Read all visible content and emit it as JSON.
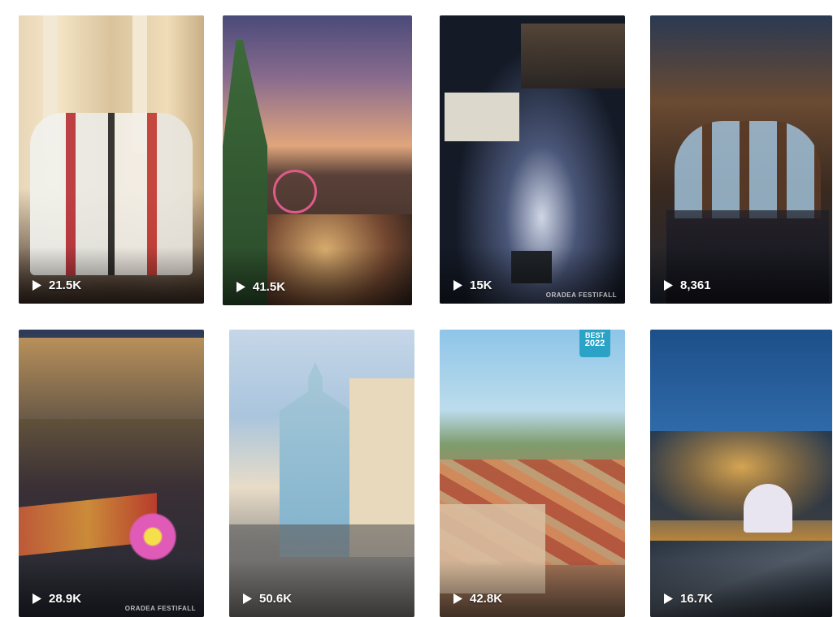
{
  "tiles": [
    {
      "count": "21.5K",
      "color": "#d9c39c"
    },
    {
      "count": "41.5K",
      "color": "#8a6c8e"
    },
    {
      "count": "15K",
      "color": "#141a26",
      "watermark": "ORADEA FESTIFALL"
    },
    {
      "count": "8,361",
      "color": "#6a4a32"
    },
    {
      "count": "28.9K",
      "color": "#2c3a5a",
      "watermark": "ORADEA FESTIFALL"
    },
    {
      "count": "50.6K",
      "color": "#a9c5dd"
    },
    {
      "count": "42.8K",
      "color": "#7e9c6c",
      "badge": [
        "BEST",
        "2022"
      ]
    },
    {
      "count": "16.7K",
      "color": "#1d4f8a"
    }
  ]
}
